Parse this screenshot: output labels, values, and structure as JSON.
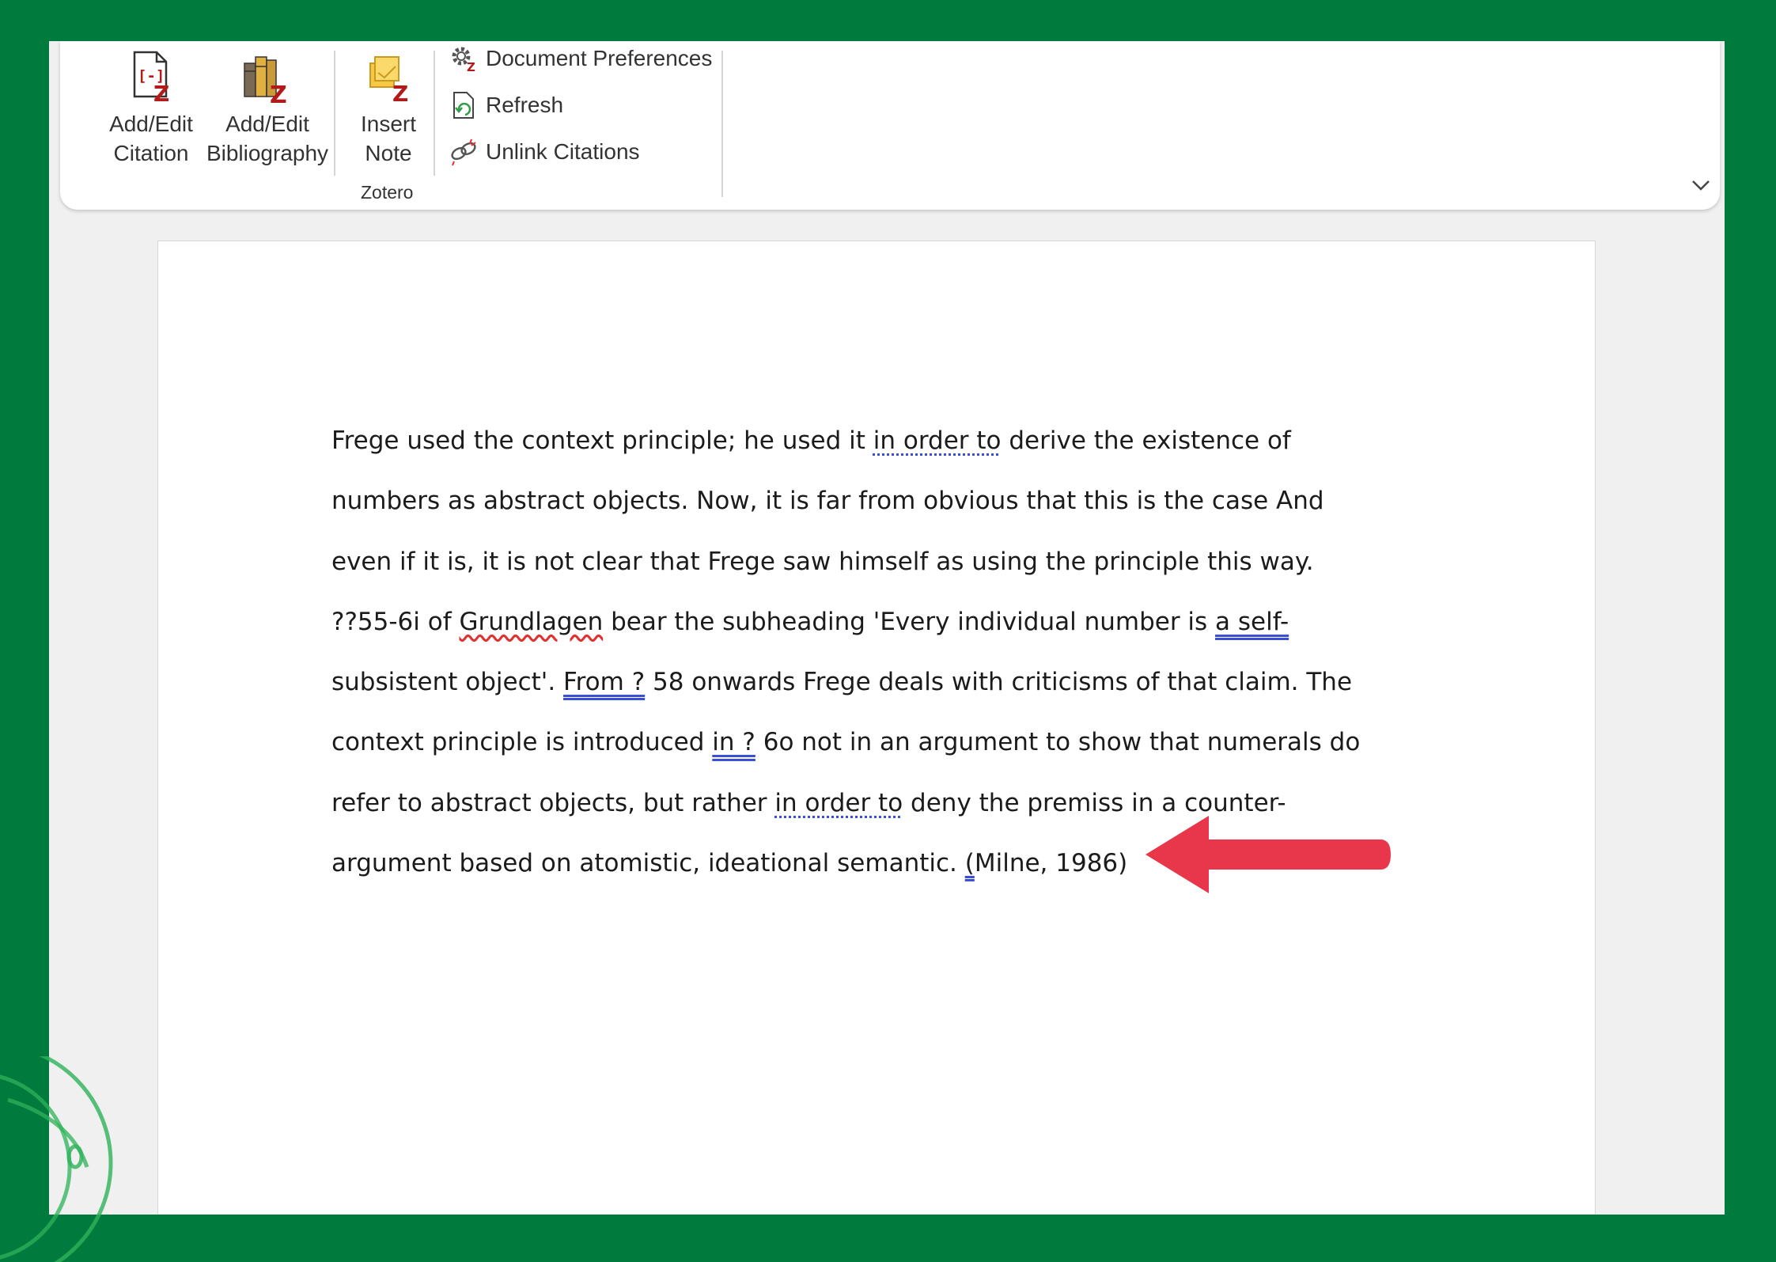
{
  "ribbon": {
    "buttons": {
      "add_edit_citation": {
        "line1": "Add/Edit",
        "line2": "Citation"
      },
      "add_edit_bibliography": {
        "line1": "Add/Edit",
        "line2": "Bibliography"
      },
      "insert_note": {
        "line1": "Insert",
        "line2": "Note"
      },
      "document_preferences": "Document Preferences",
      "refresh": "Refresh",
      "unlink_citations": "Unlink Citations"
    },
    "group_label": "Zotero"
  },
  "document": {
    "lines": [
      {
        "segments": [
          {
            "text": "Frege used the context principle; he used it ",
            "mark": ""
          },
          {
            "text": "in order to",
            "mark": "dotted"
          },
          {
            "text": " derive the existence of",
            "mark": ""
          }
        ]
      },
      {
        "segments": [
          {
            "text": "numbers as abstract objects. Now, it is far from obvious that this is the case And",
            "mark": ""
          }
        ]
      },
      {
        "segments": [
          {
            "text": "even if it is, it is not clear that Frege saw himself as using the principle this way.",
            "mark": ""
          }
        ]
      },
      {
        "segments": [
          {
            "text": "??55-6i of ",
            "mark": ""
          },
          {
            "text": "Grundlagen",
            "mark": "wavy"
          },
          {
            "text": " bear the subheading 'Every individual number is ",
            "mark": ""
          },
          {
            "text": "a self-",
            "mark": "double"
          }
        ]
      },
      {
        "segments": [
          {
            "text": "subsistent object'. ",
            "mark": ""
          },
          {
            "text": "From ?",
            "mark": "double"
          },
          {
            "text": " 58 onwards Frege deals with criticisms of that claim. The",
            "mark": ""
          }
        ]
      },
      {
        "segments": [
          {
            "text": "context principle is introduced ",
            "mark": ""
          },
          {
            "text": "in ?",
            "mark": "double"
          },
          {
            "text": " 6o not in an argument to show that numerals do",
            "mark": ""
          }
        ]
      },
      {
        "segments": [
          {
            "text": "refer to abstract objects, but rather ",
            "mark": ""
          },
          {
            "text": "in order to",
            "mark": "dotted"
          },
          {
            "text": " deny the premiss in a counter-",
            "mark": ""
          }
        ]
      },
      {
        "segments": [
          {
            "text": "argument based on atomistic, ideational semantic. ",
            "mark": ""
          },
          {
            "text": "(",
            "mark": "double"
          },
          {
            "text": "Milne, 1986)",
            "mark": ""
          }
        ]
      }
    ]
  },
  "colors": {
    "frame": "#007a3d",
    "arrow": "#e8364a",
    "zotero_red": "#b31b1b",
    "proofing_blue": "#3a4fd6",
    "spelling_red": "#e03131"
  },
  "icons": {
    "add_edit_citation": "zotero-citation-icon",
    "add_edit_bibliography": "zotero-bibliography-icon",
    "insert_note": "zotero-note-icon",
    "document_preferences": "gear-icon",
    "refresh": "refresh-document-icon",
    "unlink_citations": "unlink-icon",
    "collapse": "chevron-down-icon"
  }
}
